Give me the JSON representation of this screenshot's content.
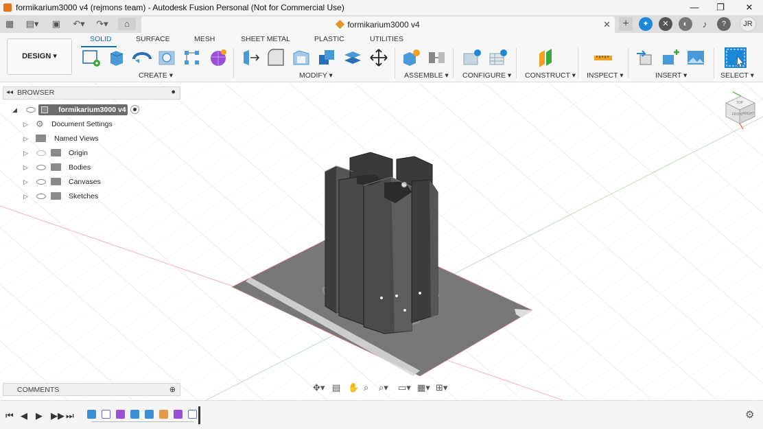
{
  "window": {
    "title": "formikarium3000 v4 (rejmons team) - Autodesk Fusion Personal (Not for Commercial Use)",
    "minimize": "—",
    "restore": "❐",
    "close": "✕"
  },
  "doc_tab": {
    "label": "formikarium3000 v4",
    "close": "✕"
  },
  "user_initials": "JR",
  "ribbon": {
    "workspace": "DESIGN ▾",
    "tabs": [
      "SOLID",
      "SURFACE",
      "MESH",
      "SHEET METAL",
      "PLASTIC",
      "UTILITIES"
    ],
    "groups": [
      "CREATE ▾",
      "MODIFY ▾",
      "ASSEMBLE ▾",
      "CONFIGURE ▾",
      "CONSTRUCT ▾",
      "INSPECT ▾",
      "INSERT ▾",
      "SELECT ▾"
    ]
  },
  "browser": {
    "header": "BROWSER",
    "root": "formikarium3000 v4",
    "items": [
      "Document Settings",
      "Named Views",
      "Origin",
      "Bodies",
      "Canvases",
      "Sketches"
    ]
  },
  "comments": {
    "header": "COMMENTS"
  },
  "viewcube": {
    "top": "TOP",
    "front": "FRONT",
    "right": "RIGHT"
  },
  "colors": {
    "accent": "#0b6dc8",
    "brand": "#e4741b",
    "body": "#3c3c3c",
    "grid": "#e6e6e6"
  }
}
